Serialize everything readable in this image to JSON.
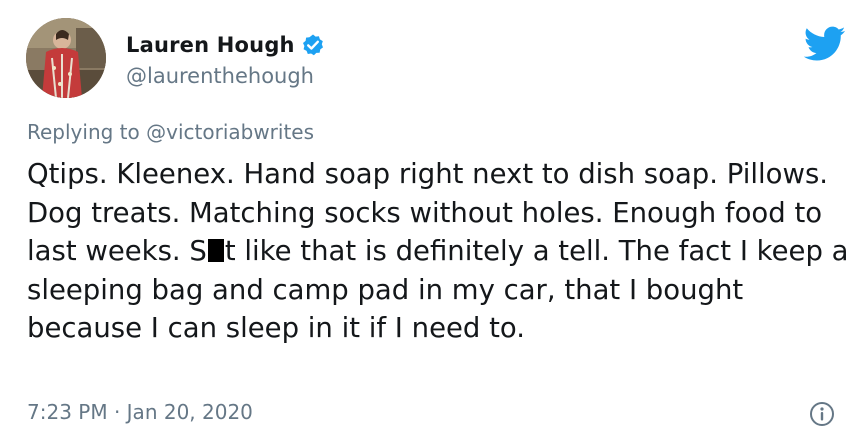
{
  "author": {
    "name": "Lauren Hough",
    "handle": "@laurenthehough",
    "verified": true
  },
  "reply": {
    "prefix": "Replying to",
    "handle": "@victoriabwrites"
  },
  "tweet": {
    "part1": "Qtips. Kleenex. Hand soap right next to dish soap. Pillows. Dog treats. Matching socks without holes. Enough food to last weeks. S",
    "part2": "t like that is definitely a tell. The fact I keep a sleeping bag and camp pad in my car, that I bought because I can sleep in it if I need to."
  },
  "meta": {
    "timestamp": "7:23 PM · Jan 20, 2020"
  },
  "icons": {
    "brand": "twitter-bird-icon",
    "verified": "verified-badge-icon",
    "info": "info-icon"
  },
  "colors": {
    "twitter_blue": "#1da1f2",
    "text_primary": "#14171a",
    "text_secondary": "#657786"
  }
}
